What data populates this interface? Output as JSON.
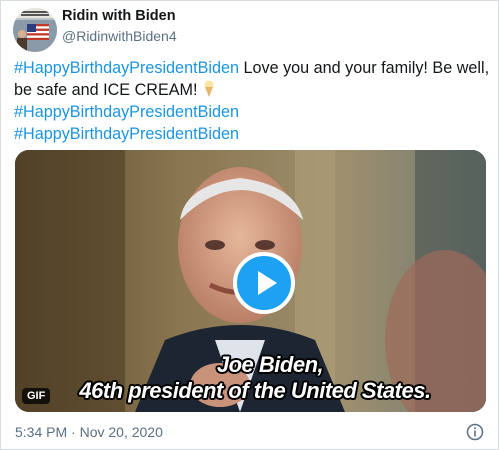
{
  "tweet": {
    "author_name": "Ridin with Biden",
    "author_handle": "@RidinwithBiden4",
    "text_parts": {
      "hashtag1": "#HappyBirthdayPresidentBiden",
      "body": " Love you and your family! Be well, be safe and ICE CREAM! ",
      "hashtag2": "#HappyBirthdayPresidentBiden",
      "hashtag3": "#HappyBirthdayPresidentBiden"
    },
    "media": {
      "caption_line1": "Joe Biden,",
      "caption_line2": "46th president of the United States.",
      "badge": "GIF"
    },
    "timestamp": "5:34 PM · Nov 20, 2020"
  },
  "icons": {
    "avatar": "avatar-flag-icon",
    "play": "play-icon",
    "info": "info-icon",
    "emoji": "ice-cream-icon"
  },
  "colors": {
    "accent": "#1da1f2",
    "hashtag": "#1b95e0",
    "secondary_text": "#5b7083"
  }
}
